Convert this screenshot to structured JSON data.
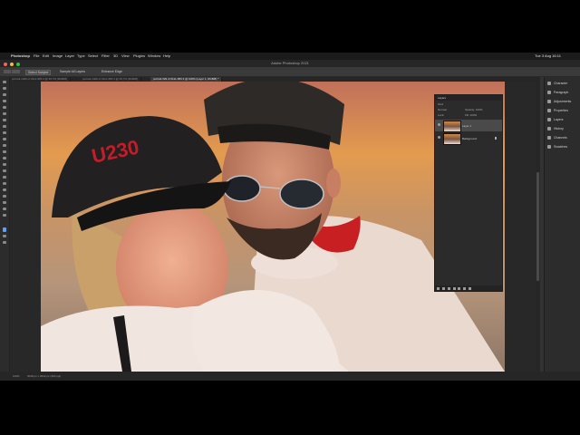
{
  "menubar": {
    "app_name": "Photoshop",
    "items": [
      "File",
      "Edit",
      "Image",
      "Layer",
      "Type",
      "Select",
      "Filter",
      "3D",
      "View",
      "Plugins",
      "Window",
      "Help"
    ],
    "status_text": "Tue 3 Aug  16:11"
  },
  "window": {
    "title": "Adobe Photoshop 2021"
  },
  "options_bar": {
    "select_subject": "Select Subject",
    "sample_all": "Sample All Layers",
    "enhance_edge": "Enhance Edge"
  },
  "tabs": [
    {
      "label": "portrait 1409 of 011L-583 4 @ 66.7% (RGB/8)",
      "active": false
    },
    {
      "label": "portrait 1409 of 011L-583 4 @ 66.7% (RGB/8)",
      "active": false
    },
    {
      "label": "portrait 329 of 011L-583 4 @ 100% (Layer 1, RGB/8) *",
      "active": true
    }
  ],
  "layers_panel": {
    "title": "Layers",
    "kind_label": "Kind",
    "mode_label": "Normal",
    "opacity_label": "Opacity: 100%",
    "lock_label": "Lock:",
    "fill_label": "Fill: 100%",
    "layers": [
      {
        "name": "Layer 1",
        "selected": true
      },
      {
        "name": "Background",
        "selected": false,
        "locked": true
      }
    ]
  },
  "right_panels": [
    {
      "label": "Character",
      "icon": "character-icon"
    },
    {
      "label": "Paragraph",
      "icon": "paragraph-icon"
    },
    {
      "label": "Adjustments",
      "icon": "adjustments-icon"
    },
    {
      "label": "Properties",
      "icon": "properties-icon"
    },
    {
      "label": "Layers",
      "icon": "layers-icon"
    },
    {
      "label": "History",
      "icon": "history-icon"
    },
    {
      "label": "Channels",
      "icon": "channels-icon"
    },
    {
      "label": "Swatches",
      "icon": "swatches-icon"
    }
  ],
  "photo": {
    "cap_text": "U230"
  },
  "status_bar": {
    "zoom": "100%",
    "doc_info": "3048 px x 2032 px (300 ppi)"
  },
  "colors": {
    "accent": "#5aa0ff",
    "panel_bg": "#2b2b2b",
    "app_bg": "#323232"
  }
}
